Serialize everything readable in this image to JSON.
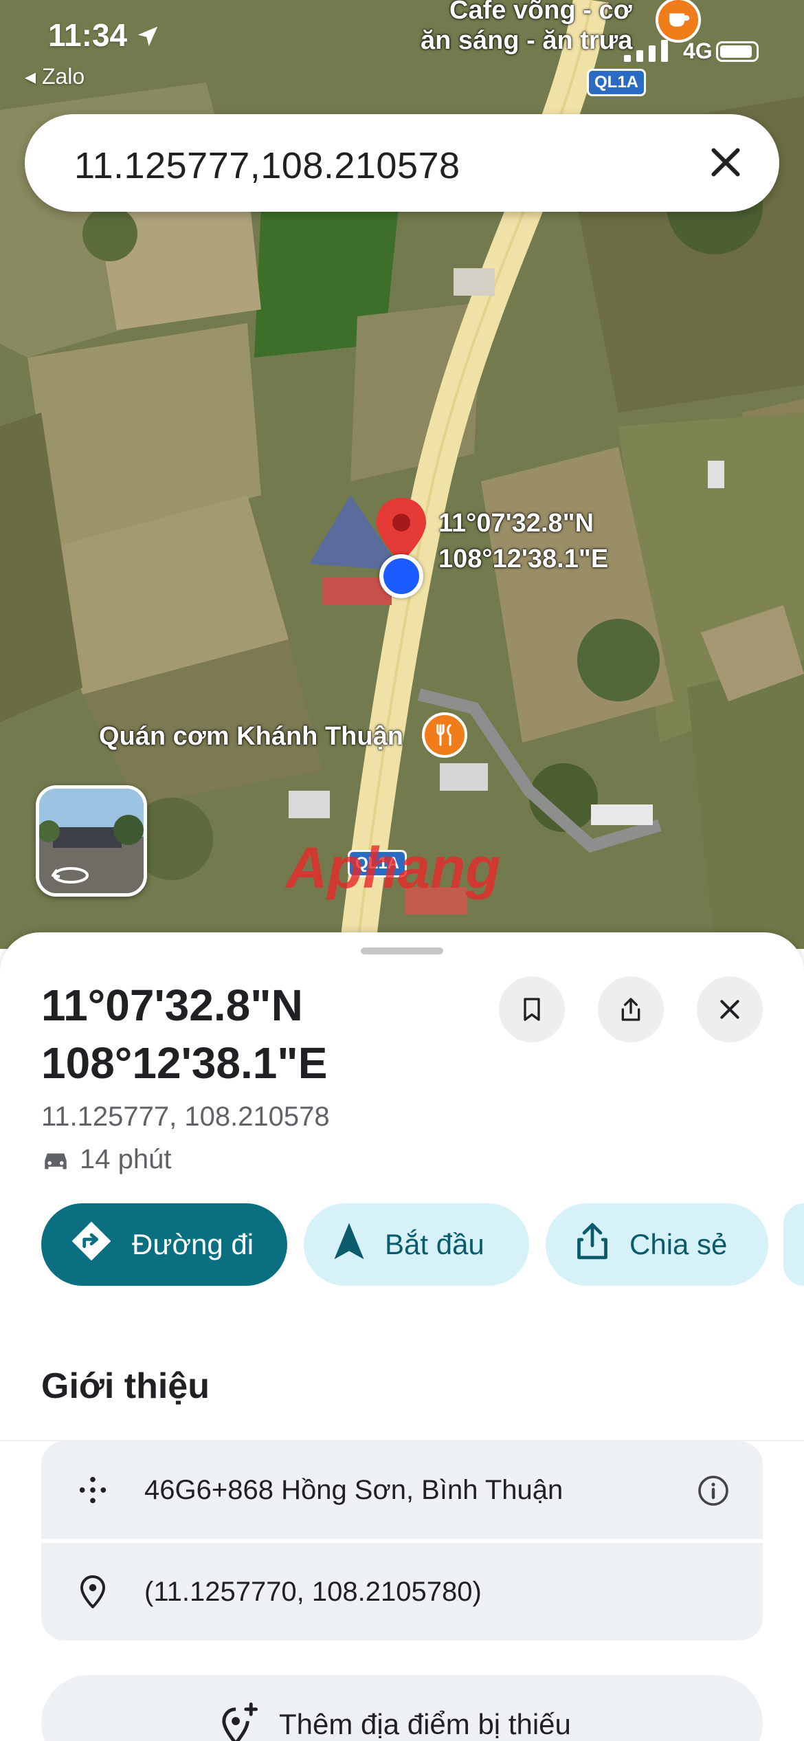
{
  "status_bar": {
    "time": "11:34",
    "back_app": "◂ Zalo",
    "network": "4G"
  },
  "search": {
    "query": "11.125777,108.210578"
  },
  "map": {
    "labels": {
      "cafe_line1": "Cafe võng - cơ",
      "cafe_line2": "ăn sáng - ăn trưa",
      "pin_lat": "11°07'32.8\"N",
      "pin_lng": "108°12'38.1\"E",
      "restaurant": "Quán cơm Khánh Thuận",
      "route_shield": "QL1A",
      "watermark": "Aphang"
    }
  },
  "place": {
    "title_line1": "11°07'32.8\"N",
    "title_line2": "108°12'38.1\"E",
    "coordinates": "11.125777, 108.210578",
    "eta": "14 phút"
  },
  "actions": {
    "directions": "Đường đi",
    "start": "Bắt đầu",
    "share": "Chia sẻ"
  },
  "about": {
    "heading": "Giới thiệu",
    "plus_code": "46G6+868 Hồng Sơn, Bình Thuận",
    "precise_coords": "(11.1257770, 108.2105780)",
    "add_missing_place": "Thêm địa điểm bị thiếu"
  },
  "colors": {
    "primary": "#0a7081",
    "chip_light": "#d6f2f8",
    "pin": "#e53935",
    "location_dot": "#1a5cff",
    "poi": "#f07c1a"
  }
}
